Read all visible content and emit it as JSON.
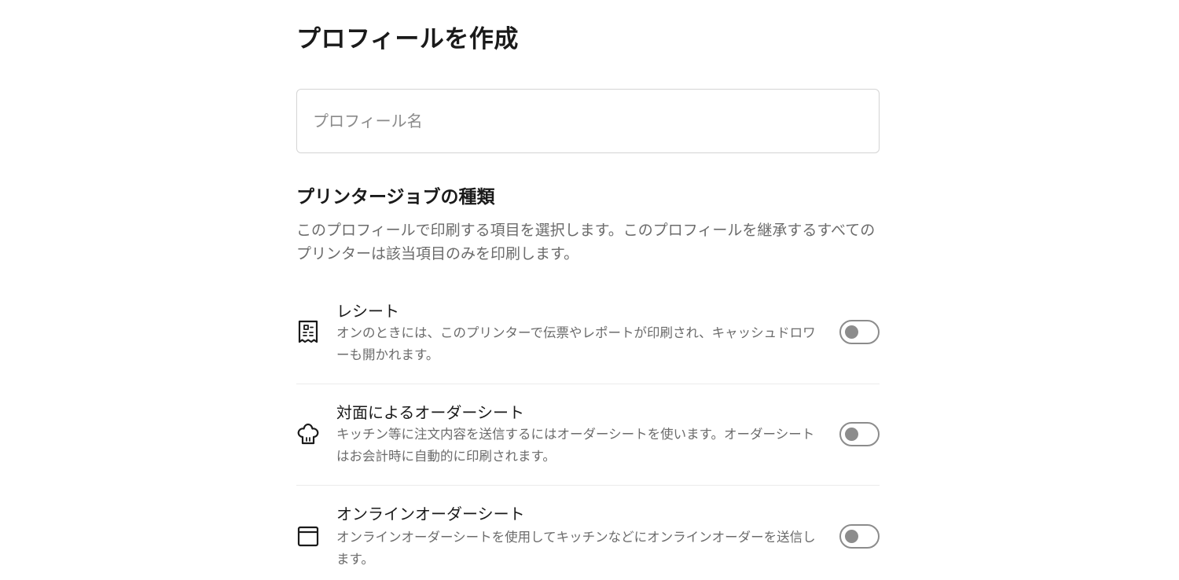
{
  "page": {
    "title": "プロフィールを作成"
  },
  "profile_name": {
    "placeholder": "プロフィール名",
    "value": ""
  },
  "printer_jobs": {
    "title": "プリンタージョブの種類",
    "description": "このプロフィールで印刷する項目を選択します。このプロフィールを継承するすべてのプリンターは該当項目のみを印刷します。",
    "items": [
      {
        "icon": "receipt-icon",
        "label": "レシート",
        "description": "オンのときには、このプリンターで伝票やレポートが印刷され、キャッシュドロワーも開かれます。",
        "enabled": false
      },
      {
        "icon": "chef-hat-icon",
        "label": "対面によるオーダーシート",
        "description": "キッチン等に注文内容を送信するにはオーダーシートを使います。オーダーシートはお会計時に自動的に印刷されます。",
        "enabled": false
      },
      {
        "icon": "browser-window-icon",
        "label": "オンラインオーダーシート",
        "description": "オンラインオーダーシートを使用してキッチンなどにオンラインオーダーを送信します。",
        "enabled": false
      }
    ]
  },
  "colors": {
    "text_primary": "#1a1a1a",
    "text_secondary": "#6b6b6b",
    "border": "#d4d4d4",
    "divider": "#ececec",
    "toggle_off": "#8c8c8c"
  }
}
